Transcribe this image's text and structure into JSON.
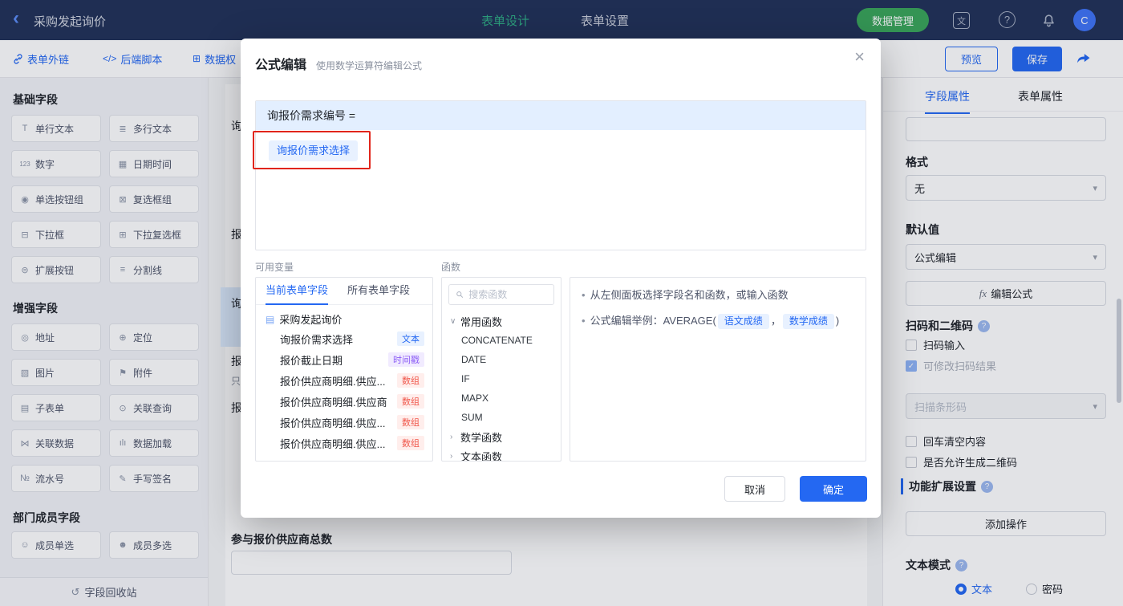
{
  "icons": {
    "caret": "▾",
    "check": "✓",
    "bullet": "•",
    "chev_down": "∨",
    "chev_right": "›",
    "back": "‹",
    "close": "×",
    "lang": "文",
    "help": "?",
    "doc": "▤",
    "recycle": "↺",
    "fx": "fx",
    "code": "</>",
    "grid": "⊞"
  },
  "topbar": {
    "title": "采购发起询价",
    "tab_design": "表单设计",
    "tab_settings": "表单设置",
    "data_manage": "数据管理",
    "avatar": "C"
  },
  "toolbar": {
    "link1": "表单外链",
    "link2": "后端脚本",
    "link3": "数据权",
    "preview": "预览",
    "save": "保存"
  },
  "palette": {
    "sections": [
      {
        "title": "基础字段",
        "fields": [
          {
            "icon": "T",
            "label": "单行文本"
          },
          {
            "icon": "≣",
            "label": "多行文本"
          },
          {
            "icon": "123",
            "label": "数字"
          },
          {
            "icon": "▦",
            "label": "日期时间"
          },
          {
            "icon": "◉",
            "label": "单选按钮组"
          },
          {
            "icon": "⊠",
            "label": "复选框组"
          },
          {
            "icon": "⊟",
            "label": "下拉框"
          },
          {
            "icon": "⊞",
            "label": "下拉复选框"
          },
          {
            "icon": "⊜",
            "label": "扩展按钮"
          },
          {
            "icon": "≡",
            "label": "分割线"
          }
        ]
      },
      {
        "title": "增强字段",
        "fields": [
          {
            "icon": "◎",
            "label": "地址"
          },
          {
            "icon": "⊕",
            "label": "定位"
          },
          {
            "icon": "▧",
            "label": "图片"
          },
          {
            "icon": "⚑",
            "label": "附件"
          },
          {
            "icon": "▤",
            "label": "子表单"
          },
          {
            "icon": "⊙",
            "label": "关联查询"
          },
          {
            "icon": "⋈",
            "label": "关联数据"
          },
          {
            "icon": "ılı",
            "label": "数据加载"
          },
          {
            "icon": "№",
            "label": "流水号"
          },
          {
            "icon": "✎",
            "label": "手写签名"
          }
        ]
      },
      {
        "title": "部门成员字段",
        "fields": [
          {
            "icon": "☺",
            "label": "成员单选"
          },
          {
            "icon": "☻",
            "label": "成员多选"
          }
        ]
      }
    ],
    "recycle": "字段回收站"
  },
  "canvas": {
    "fragments": [
      "询",
      "报",
      "询",
      "报",
      "只",
      "报"
    ],
    "field_label": "参与报价供应商总数"
  },
  "props": {
    "tab_field": "字段属性",
    "tab_form": "表单属性",
    "format_label": "格式",
    "format_value": "无",
    "default_label": "默认值",
    "default_value": "公式编辑",
    "edit_formula": "编辑公式",
    "scan_title": "扫码和二维码",
    "cb_scan": "扫码输入",
    "cb_modify": "可修改扫码结果",
    "scan_select": "扫描条形码",
    "cb_enter": "回车清空内容",
    "cb_qr": "是否允许生成二维码",
    "ext_title": "功能扩展设置",
    "add_action": "添加操作",
    "text_mode": "文本模式",
    "radio_text": "文本",
    "radio_pwd": "密码"
  },
  "modal": {
    "title": "公式编辑",
    "subtitle": "使用数学运算符编辑公式",
    "target": "询报价需求编号 =",
    "chip": "询报价需求选择",
    "vars_label": "可用变量",
    "funcs_label": "函数",
    "tab_current": "当前表单字段",
    "tab_all": "所有表单字段",
    "root": "采购发起询价",
    "vars": [
      {
        "name": "询报价需求选择",
        "tag": "文本"
      },
      {
        "name": "报价截止日期",
        "tag": "时间戳"
      },
      {
        "name": "报价供应商明细.供应...",
        "tag": "数组"
      },
      {
        "name": "报价供应商明细.供应商",
        "tag": "数组"
      },
      {
        "name": "报价供应商明细.供应...",
        "tag": "数组"
      },
      {
        "name": "报价供应商明细.供应...",
        "tag": "数组"
      }
    ],
    "search_placeholder": "搜索函数",
    "group_common": "常用函数",
    "funcs": [
      "CONCATENATE",
      "DATE",
      "IF",
      "MAPX",
      "SUM"
    ],
    "group_math": "数学函数",
    "group_text": "文本函数",
    "help1": "从左侧面板选择字段名和函数，或输入函数",
    "help2_pre": "公式编辑举例：AVERAGE(",
    "help2_c1": "语文成绩",
    "help2_sep": "，",
    "help2_c2": "数学成绩",
    "help2_post": ")",
    "cancel": "取消",
    "ok": "确定"
  }
}
